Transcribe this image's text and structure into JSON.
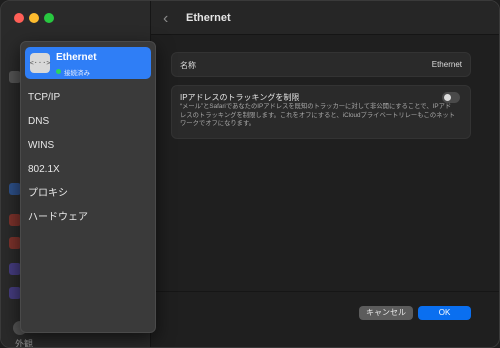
{
  "window": {
    "title": "Ethernet"
  },
  "colors": {
    "accent": "#2f7ef6",
    "ok_button": "#0a6ff0",
    "status_green": "#2bd65d"
  },
  "sheet": {
    "selected": {
      "name": "Ethernet",
      "status": "接続済み",
      "icon": "ethernet-icon"
    },
    "items": [
      "TCP/IP",
      "DNS",
      "WINS",
      "802.1X",
      "プロキシ",
      "ハードウェア"
    ]
  },
  "main": {
    "name_label": "名称",
    "name_value": "Ethernet",
    "ip_tracking": {
      "title": "IPアドレスのトラッキングを制限",
      "description": "“メール”とSafariであなたのIPアドレスを既知のトラッカーに対して非公開にすることで、IPアドレスのトラッキングを制限します。これをオフにすると、iCloudプライベートリレーもこのネットワークでオフになります。",
      "enabled": false
    }
  },
  "buttons": {
    "cancel": "キャンセル",
    "ok": "OK"
  },
  "background_bottom": {
    "label": "外観"
  }
}
